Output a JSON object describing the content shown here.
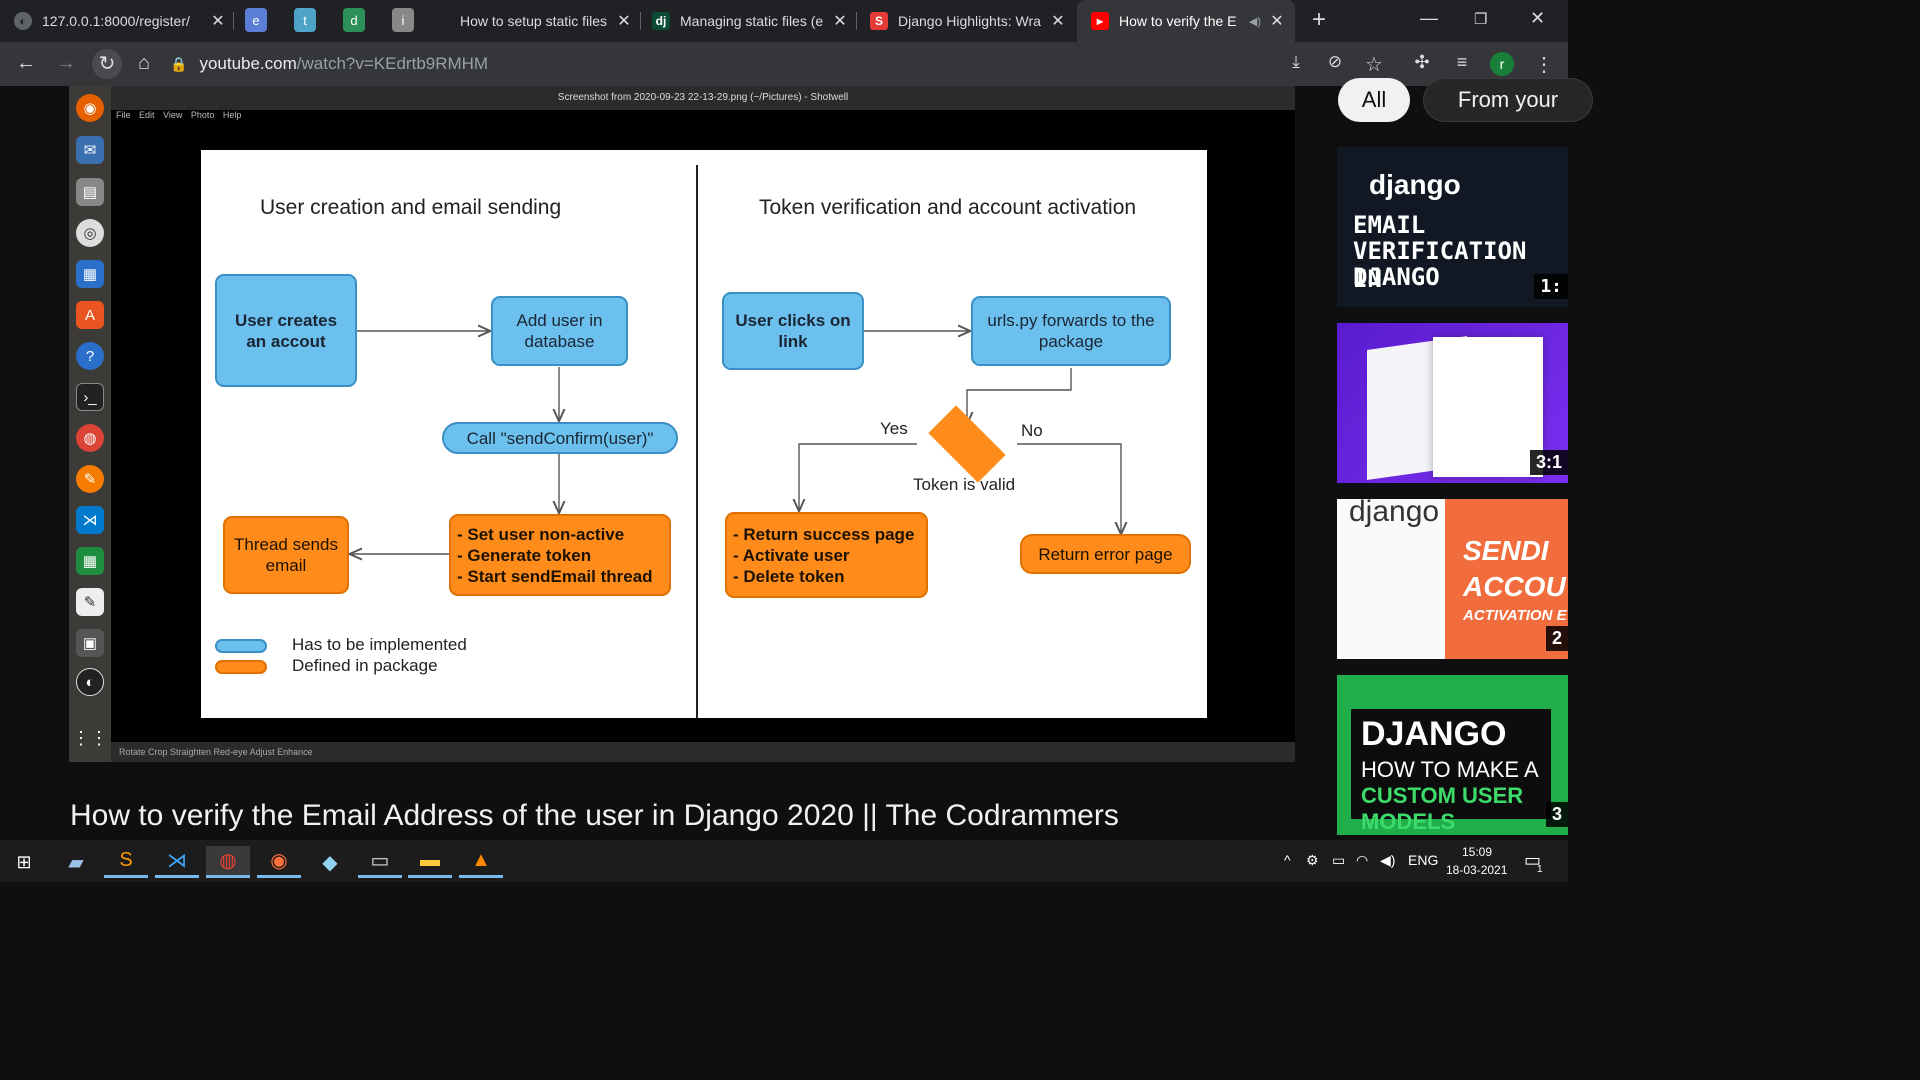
{
  "browser": {
    "tabs": [
      {
        "title": "127.0.0.1:8000/register/",
        "icon": "globe-icon"
      },
      {
        "title": "e",
        "pinned": true,
        "color": "#5b7fd6"
      },
      {
        "title": "t",
        "pinned": true,
        "color": "#4fa3c7"
      },
      {
        "title": "d",
        "pinned": true,
        "color": "#2d8f5a"
      },
      {
        "title": "i",
        "pinned": true,
        "color": "#888888"
      },
      {
        "title": "How to setup static files"
      },
      {
        "title": "Managing static files (e",
        "icon_text": "dj"
      },
      {
        "title": "Django Highlights: Wra",
        "icon_text": "S"
      },
      {
        "title": "How to verify the E",
        "active": true,
        "muted_icon": "speaker-muted-icon"
      }
    ],
    "new_tab": "+",
    "address": {
      "host": "youtube.com",
      "path": "/watch?v=KEdrtb9RMHM"
    },
    "profile_initial": "r"
  },
  "video_frame": {
    "window_title": "Screenshot from 2020-09-23 22-13-29.png (~/Pictures) - Shotwell",
    "menu": "File Edit View Photo Help",
    "bottom_tools": "Rotate  Crop  Straighten  Red-eye  Adjust  Enhance",
    "diagram": {
      "left_heading": "User creation and email sending",
      "right_heading": "Token verification and account activation",
      "nodes": {
        "user_creates": "User creates\nan accout",
        "add_user": "Add user in\ndatabase",
        "call_send": "Call \"sendConfirm(user)\"",
        "set_user": "- Set user non-active\n- Generate token\n- Start sendEmail thread",
        "thread_sends": "Thread sends\nemail",
        "user_clicks": "User clicks on\nlink",
        "urls_forwards": "urls.py forwards to the\npackage",
        "return_success": "- Return success page\n- Activate user\n- Delete token",
        "return_error": "Return error page"
      },
      "yes": "Yes",
      "no": "No",
      "token_valid": "Token is valid",
      "legend": {
        "blue": "Has to be implemented",
        "orange": "Defined in package"
      },
      "colors": {
        "blue": "#6cc0ee",
        "orange": "#ff8c1a"
      }
    }
  },
  "video_title": "How to verify the Email Address of the user in Django 2020 || The Codrammers",
  "sidebar": {
    "chips": [
      "All",
      "From your"
    ],
    "thumbnails": [
      {
        "line1": "django",
        "line2": "EMAIL",
        "line3": "VERIFICATION IN",
        "line4": "DJANGO",
        "duration": "1:"
      },
      {
        "duration": "3:1"
      },
      {
        "line1": "django",
        "line2": "SENDI",
        "line3": "ACCOU",
        "line4": "ACTIVATION E",
        "duration": "2"
      },
      {
        "line1": "DJANGO",
        "line2": "HOW TO MAKE A",
        "line3": "CUSTOM USER MODELS",
        "duration": "3"
      }
    ]
  },
  "taskbar": {
    "language": "ENG",
    "time": "15:09",
    "date": "18-03-2021",
    "notifications": "1"
  }
}
